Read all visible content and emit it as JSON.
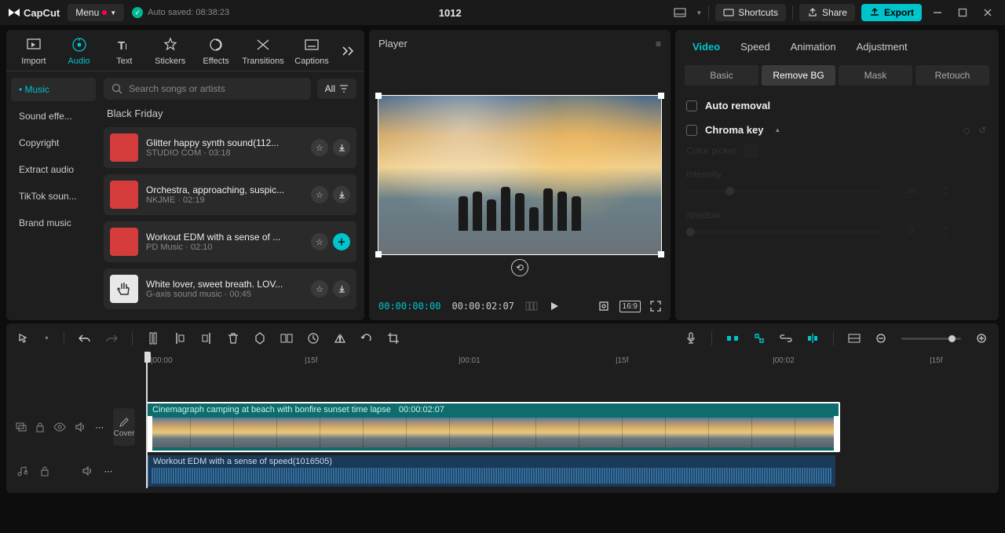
{
  "titlebar": {
    "app": "CapCut",
    "menu": "Menu",
    "saved_label": "Auto saved: 08:38:23",
    "title": "1012",
    "shortcuts": "Shortcuts",
    "share": "Share",
    "export": "Export"
  },
  "left_tabs": {
    "import": "Import",
    "audio": "Audio",
    "text": "Text",
    "stickers": "Stickers",
    "effects": "Effects",
    "transitions": "Transitions",
    "captions": "Captions"
  },
  "sidebar": {
    "items": [
      "Music",
      "Sound effe...",
      "Copyright",
      "Extract audio",
      "TikTok soun...",
      "Brand music"
    ]
  },
  "search": {
    "placeholder": "Search songs or artists",
    "filter": "All"
  },
  "section_title": "Black Friday",
  "tracks": [
    {
      "title": "Glitter happy synth sound(112...",
      "meta": "STUDIO COM · 03:18",
      "thumb_bg": "#d43c3c",
      "thumb_svg": "moon",
      "add": false
    },
    {
      "title": "Orchestra, approaching, suspic...",
      "meta": "NKJME · 02:19",
      "thumb_bg": "#d43c3c",
      "thumb_svg": "moon",
      "add": false
    },
    {
      "title": "Workout EDM with a sense of ...",
      "meta": "PD Music · 02:10",
      "thumb_bg": "#d43c3c",
      "thumb_svg": "moon",
      "add": true
    },
    {
      "title": "White lover, sweet breath. LOV...",
      "meta": "G-axis sound music · 00:45",
      "thumb_bg": "#e8e8e8",
      "thumb_svg": "hand",
      "add": false
    }
  ],
  "player": {
    "title": "Player",
    "tc_current": "00:00:00:00",
    "tc_duration": "00:00:02:07",
    "ratio": "16:9"
  },
  "right_tabs": [
    "Video",
    "Speed",
    "Animation",
    "Adjustment"
  ],
  "sub_tabs": [
    "Basic",
    "Remove BG",
    "Mask",
    "Retouch"
  ],
  "props": {
    "auto_removal": "Auto removal",
    "chroma_key": "Chroma key",
    "color_picker": "Color picker",
    "intensity": "Intensity",
    "intensity_val": "20",
    "shadow": "Shadow",
    "shadow_val": "0"
  },
  "timeline": {
    "cover": "Cover",
    "ruler": [
      "00:00",
      "15f",
      "00:01",
      "15f",
      "00:02",
      "15f"
    ],
    "video_clip": {
      "name": "Cinemagraph camping at beach with bonfire sunset time lapse",
      "dur": "00:00:02:07"
    },
    "audio_clip": {
      "name": "Workout EDM with a sense of speed(1016505)"
    }
  }
}
